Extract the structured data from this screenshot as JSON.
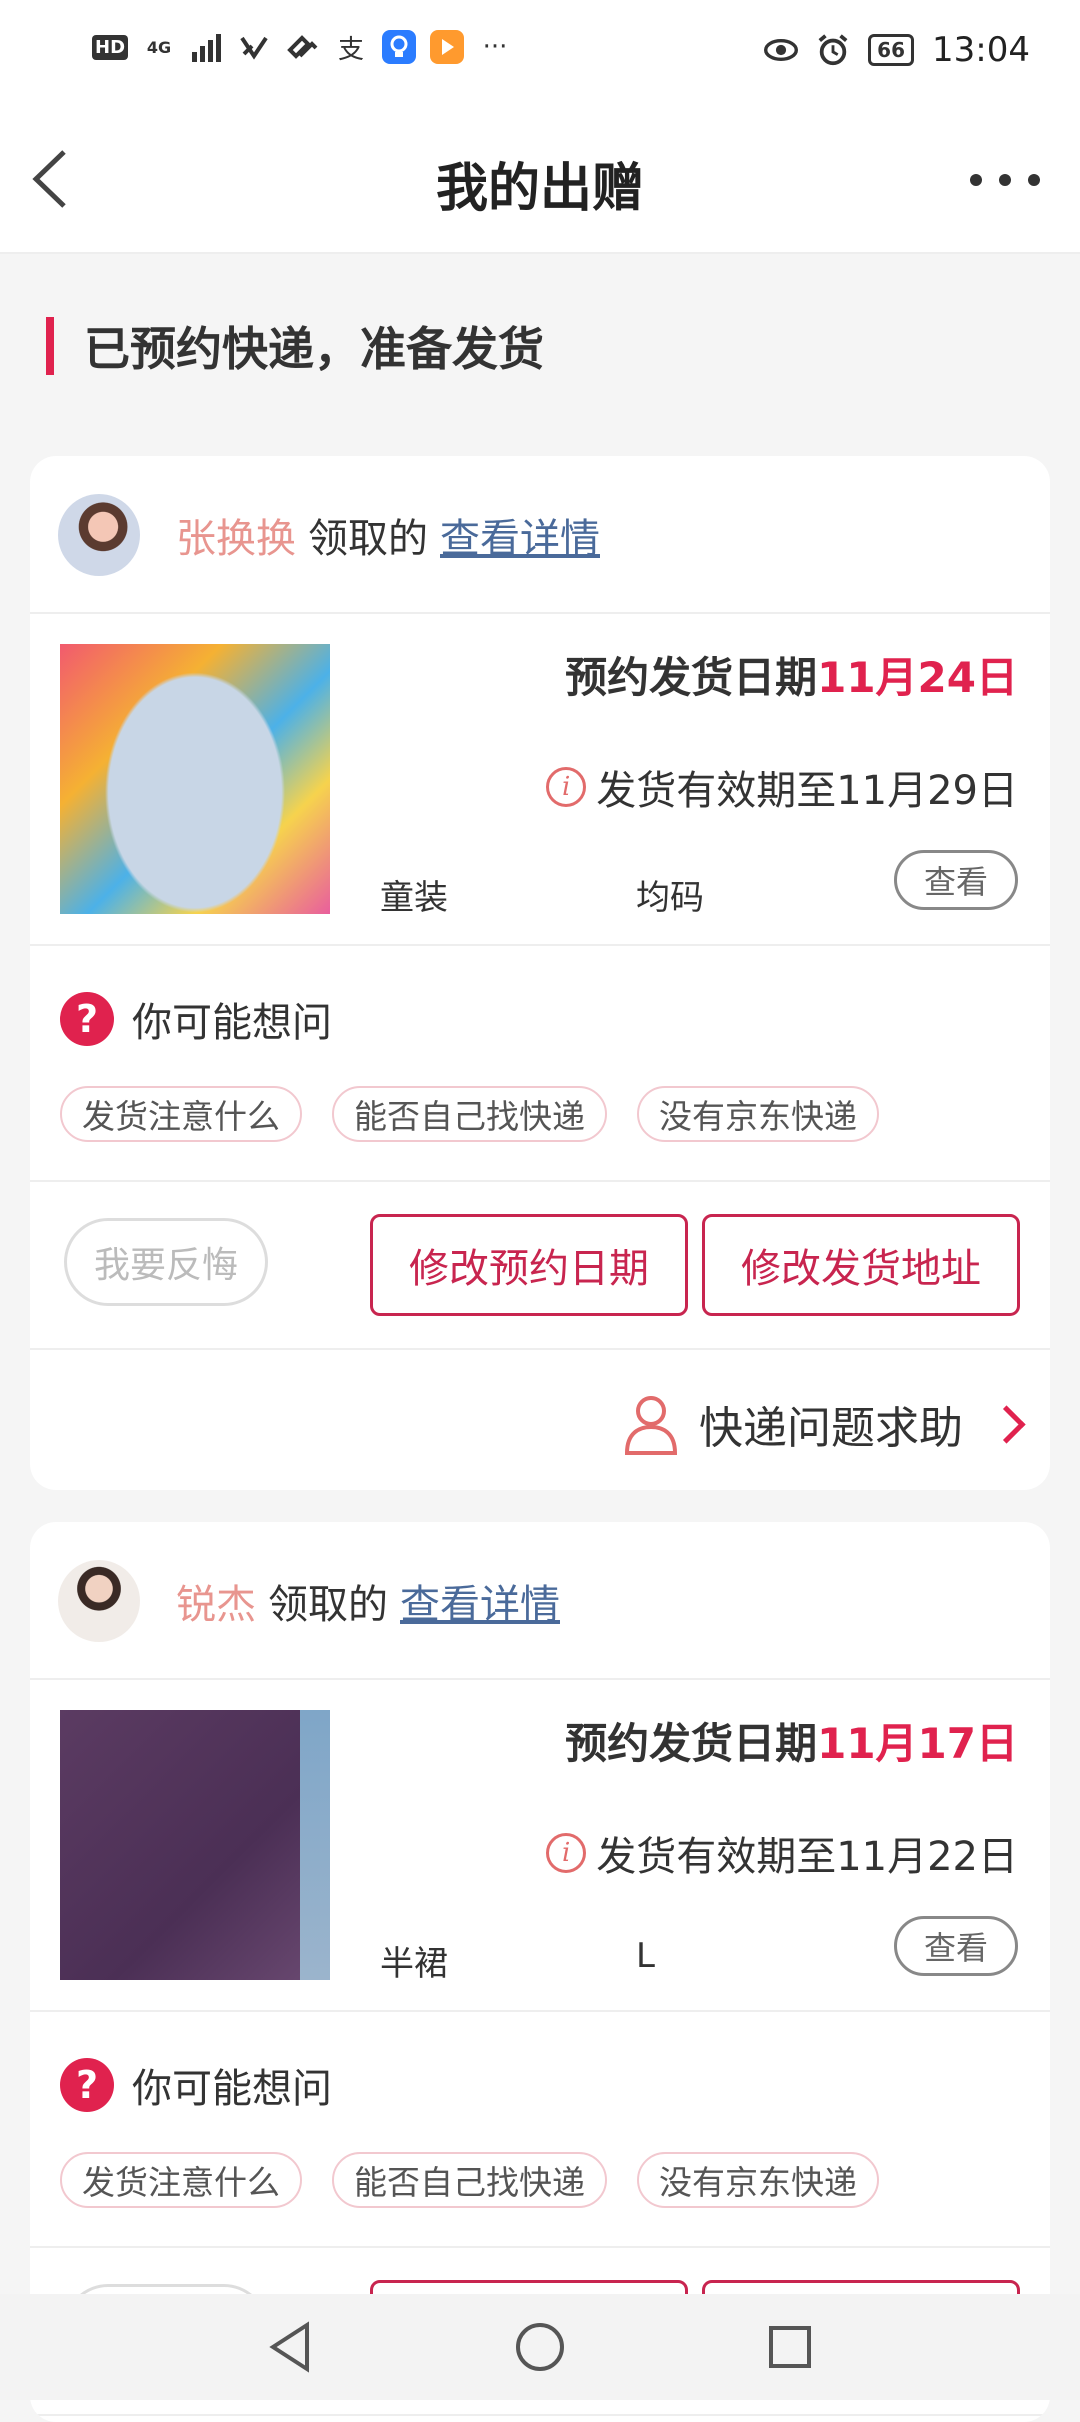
{
  "status_bar": {
    "hd": "HD",
    "network": "4G",
    "app1_glyph": "支",
    "more": "···",
    "battery": "66",
    "time": "13:04",
    "icons": [
      "signal-icon",
      "messaging-icon",
      "link-icon",
      "alipay-icon",
      "app-blue-icon",
      "app-orange-icon",
      "eye-icon",
      "alarm-icon",
      "battery-icon"
    ]
  },
  "header": {
    "title": "我的出赠"
  },
  "section": {
    "title": "已预约快递，准备发货"
  },
  "cards": [
    {
      "user_name": "张换换",
      "claimed_text": "领取的",
      "detail_link": "查看详情",
      "ship_label": "预约发货日期",
      "ship_date": "11月24日",
      "valid_text": "发货有效期至11月29日",
      "category": "童装",
      "size": "均码",
      "view_label": "查看",
      "faq_title": "你可能想问",
      "chips": [
        "发货注意什么",
        "能否自己找快递",
        "没有京东快递"
      ],
      "regret_label": "我要反悔",
      "change_date_label": "修改预约日期",
      "change_address_label": "修改发货地址",
      "help_label": "快递问题求助"
    },
    {
      "user_name": "锐杰",
      "claimed_text": "领取的",
      "detail_link": "查看详情",
      "ship_label": "预约发货日期",
      "ship_date": "11月17日",
      "valid_text": "发货有效期至11月22日",
      "category": "半裙",
      "size": "L",
      "view_label": "查看",
      "faq_title": "你可能想问",
      "chips": [
        "发货注意什么",
        "能否自己找快递",
        "没有京东快递"
      ]
    }
  ],
  "colors": {
    "accent": "#e0224e",
    "button_border": "#c8254f",
    "name_pink": "#e8958f",
    "link_blue": "#4a6a9a"
  }
}
